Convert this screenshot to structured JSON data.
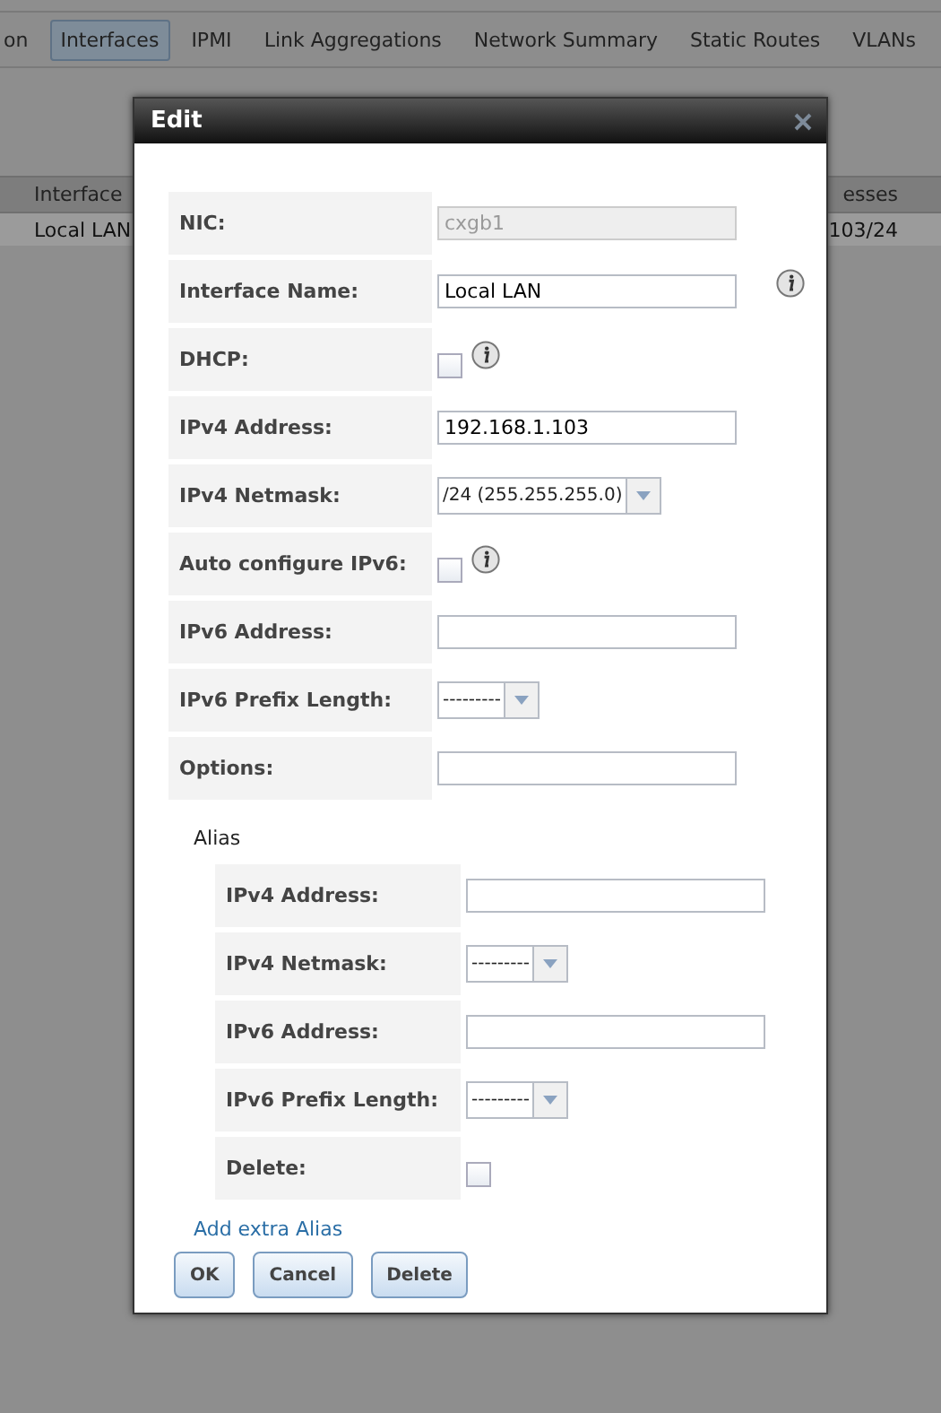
{
  "tabs": [
    {
      "label": "on",
      "selected": false
    },
    {
      "label": "Interfaces",
      "selected": true
    },
    {
      "label": "IPMI",
      "selected": false
    },
    {
      "label": "Link Aggregations",
      "selected": false
    },
    {
      "label": "Network Summary",
      "selected": false
    },
    {
      "label": "Static Routes",
      "selected": false
    },
    {
      "label": "VLANs",
      "selected": false
    }
  ],
  "table": {
    "columns": [
      "Interface",
      "esses"
    ],
    "rows": [
      [
        "Local LAN",
        "103/24"
      ]
    ]
  },
  "dialog": {
    "title": "Edit",
    "fields": [
      {
        "label": "NIC:",
        "kind": "text",
        "value": "cxgb1",
        "disabled": true,
        "info": false
      },
      {
        "label": "Interface Name:",
        "kind": "text",
        "value": "Local LAN",
        "disabled": false,
        "info": true
      },
      {
        "label": "DHCP:",
        "kind": "checkbox",
        "checked": false,
        "info": true
      },
      {
        "label": "IPv4 Address:",
        "kind": "text",
        "value": "192.168.1.103",
        "disabled": false,
        "info": false
      },
      {
        "label": "IPv4 Netmask:",
        "kind": "select",
        "value": "/24 (255.255.255.0)",
        "info": false
      },
      {
        "label": "Auto configure IPv6:",
        "kind": "checkbox",
        "checked": false,
        "info": true
      },
      {
        "label": "IPv6 Address:",
        "kind": "text",
        "disabled": false,
        "info": false
      },
      {
        "label": "IPv6 Prefix Length:",
        "kind": "select",
        "value": "---------",
        "info": false
      },
      {
        "label": "Options:",
        "kind": "text",
        "disabled": false,
        "info": false
      }
    ],
    "alias": {
      "title": "Alias",
      "fields": [
        {
          "label": "IPv4 Address:",
          "kind": "text",
          "disabled": false,
          "info": false
        },
        {
          "label": "IPv4 Netmask:",
          "kind": "select",
          "value": "---------",
          "info": false
        },
        {
          "label": "IPv6 Address:",
          "kind": "text",
          "disabled": false,
          "info": false
        },
        {
          "label": "IPv6 Prefix Length:",
          "kind": "select",
          "value": "---------",
          "info": false
        },
        {
          "label": "Delete:",
          "kind": "checkbox",
          "checked": false,
          "info": false
        }
      ]
    },
    "add_link": "Add extra Alias",
    "buttons": [
      "OK",
      "Cancel",
      "Delete"
    ]
  }
}
